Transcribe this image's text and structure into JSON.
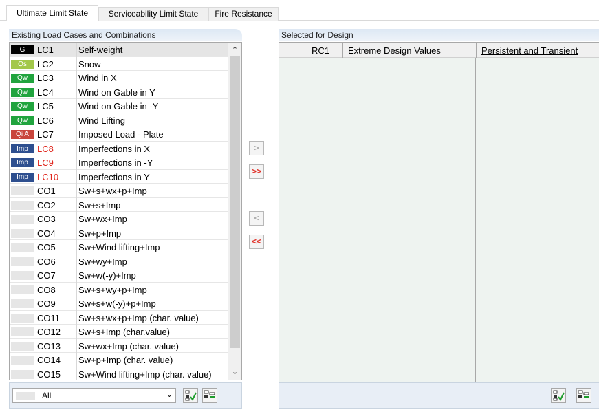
{
  "tabs": [
    {
      "label": "Ultimate Limit State",
      "active": true
    },
    {
      "label": "Serviceability Limit State",
      "active": false
    },
    {
      "label": "Fire Resistance",
      "active": false
    }
  ],
  "left_panel": {
    "header": "Existing Load Cases and Combinations",
    "rows": [
      {
        "badge": "G",
        "badge_color": "#000000",
        "code": "LC1",
        "desc": "Self-weight",
        "selected": true,
        "red": false
      },
      {
        "badge": "Qs",
        "badge_color": "#a3c84b",
        "code": "LC2",
        "desc": "Snow",
        "selected": false,
        "red": false
      },
      {
        "badge": "Qw",
        "badge_color": "#21a43e",
        "code": "LC3",
        "desc": "Wind in X",
        "selected": false,
        "red": false
      },
      {
        "badge": "Qw",
        "badge_color": "#21a43e",
        "code": "LC4",
        "desc": "Wind on Gable in Y",
        "selected": false,
        "red": false
      },
      {
        "badge": "Qw",
        "badge_color": "#21a43e",
        "code": "LC5",
        "desc": "Wind on Gable in -Y",
        "selected": false,
        "red": false
      },
      {
        "badge": "Qw",
        "badge_color": "#21a43e",
        "code": "LC6",
        "desc": "Wind Lifting",
        "selected": false,
        "red": false
      },
      {
        "badge": "Qi A",
        "badge_color": "#c9463d",
        "code": "LC7",
        "desc": "Imposed Load - Plate",
        "selected": false,
        "red": false
      },
      {
        "badge": "Imp",
        "badge_color": "#2e4f8f",
        "code": "LC8",
        "desc": "Imperfections in X",
        "selected": false,
        "red": true
      },
      {
        "badge": "Imp",
        "badge_color": "#2e4f8f",
        "code": "LC9",
        "desc": "Imperfections in -Y",
        "selected": false,
        "red": true
      },
      {
        "badge": "Imp",
        "badge_color": "#2e4f8f",
        "code": "LC10",
        "desc": "Imperfections in Y",
        "selected": false,
        "red": true
      },
      {
        "badge": "",
        "badge_color": "#e6e6e6",
        "code": "CO1",
        "desc": "Sw+s+wx+p+Imp",
        "selected": false,
        "red": false
      },
      {
        "badge": "",
        "badge_color": "#e6e6e6",
        "code": "CO2",
        "desc": "Sw+s+Imp",
        "selected": false,
        "red": false
      },
      {
        "badge": "",
        "badge_color": "#e6e6e6",
        "code": "CO3",
        "desc": "Sw+wx+Imp",
        "selected": false,
        "red": false
      },
      {
        "badge": "",
        "badge_color": "#e6e6e6",
        "code": "CO4",
        "desc": "Sw+p+Imp",
        "selected": false,
        "red": false
      },
      {
        "badge": "",
        "badge_color": "#e6e6e6",
        "code": "CO5",
        "desc": "Sw+Wind lifting+Imp",
        "selected": false,
        "red": false
      },
      {
        "badge": "",
        "badge_color": "#e6e6e6",
        "code": "CO6",
        "desc": "Sw+wy+Imp",
        "selected": false,
        "red": false
      },
      {
        "badge": "",
        "badge_color": "#e6e6e6",
        "code": "CO7",
        "desc": "Sw+w(-y)+Imp",
        "selected": false,
        "red": false
      },
      {
        "badge": "",
        "badge_color": "#e6e6e6",
        "code": "CO8",
        "desc": "Sw+s+wy+p+Imp",
        "selected": false,
        "red": false
      },
      {
        "badge": "",
        "badge_color": "#e6e6e6",
        "code": "CO9",
        "desc": "Sw+s+w(-y)+p+Imp",
        "selected": false,
        "red": false
      },
      {
        "badge": "",
        "badge_color": "#e6e6e6",
        "code": "CO11",
        "desc": "Sw+s+wx+p+Imp (char. value)",
        "selected": false,
        "red": false
      },
      {
        "badge": "",
        "badge_color": "#e6e6e6",
        "code": "CO12",
        "desc": "Sw+s+Imp (char.value)",
        "selected": false,
        "red": false
      },
      {
        "badge": "",
        "badge_color": "#e6e6e6",
        "code": "CO13",
        "desc": "Sw+wx+Imp (char. value)",
        "selected": false,
        "red": false
      },
      {
        "badge": "",
        "badge_color": "#e6e6e6",
        "code": "CO14",
        "desc": "Sw+p+Imp (char. value)",
        "selected": false,
        "red": false
      },
      {
        "badge": "",
        "badge_color": "#e6e6e6",
        "code": "CO15",
        "desc": "Sw+Wind lifting+Imp (char. value)",
        "selected": false,
        "red": false
      }
    ],
    "filter_value": "All"
  },
  "transfer_buttons": {
    "add_one": ">",
    "add_all": ">>",
    "remove_one": "<",
    "remove_all": "<<"
  },
  "right_panel": {
    "header": "Selected for Design",
    "row": {
      "code": "RC1",
      "type": "Extreme Design Values",
      "situation": "Persistent and Transient"
    }
  }
}
